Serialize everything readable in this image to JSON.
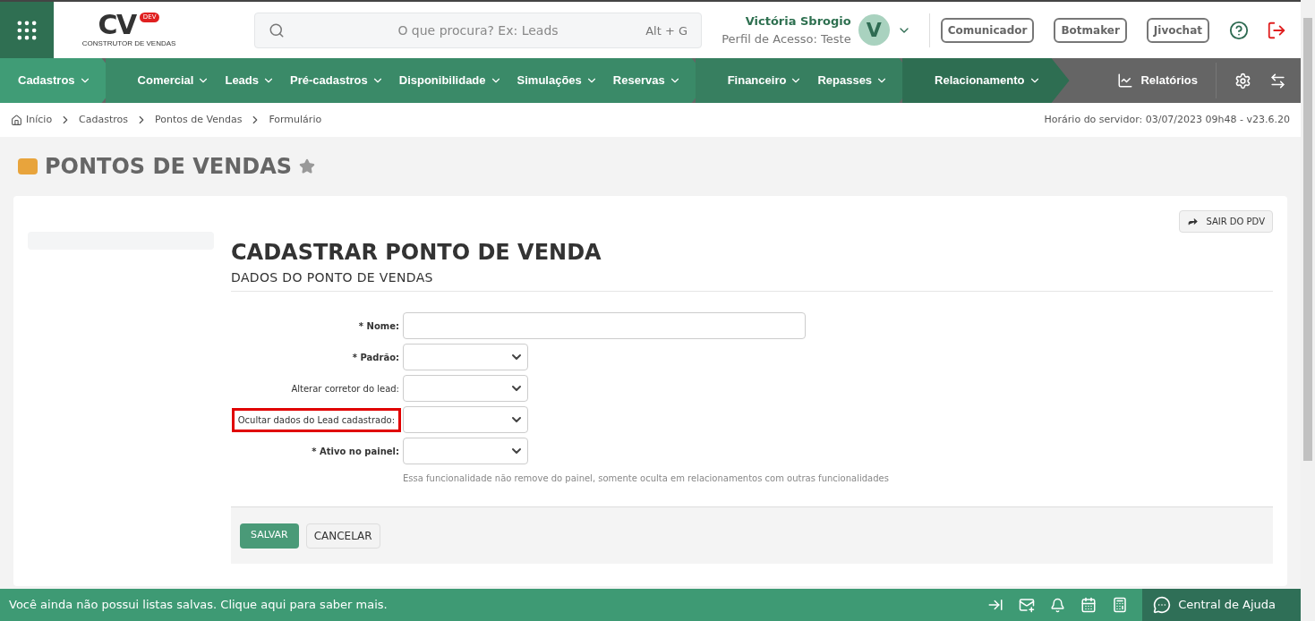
{
  "logo": {
    "letters": "CV",
    "badge": "DEV",
    "tagline": "CONSTRUTOR DE VENDAS"
  },
  "search": {
    "placeholder": "O que procura? Ex: Leads",
    "shortcut": "Alt + G"
  },
  "user": {
    "name": "Victória Sbrogio",
    "profile": "Perfil de Acesso: Teste",
    "initial": "V"
  },
  "header_buttons": [
    "Comunicador",
    "Botmaker",
    "Jivochat"
  ],
  "nav_groups": [
    {
      "color": "#409c76",
      "items": [
        "Cadastros"
      ]
    },
    {
      "color": "#3a8a68",
      "items": [
        "Comercial",
        "Leads",
        "Pré-cadastros",
        "Disponibilidade",
        "Simulações",
        "Reservas"
      ]
    },
    {
      "color": "#377f60",
      "items": [
        "Financeiro",
        "Repasses"
      ]
    },
    {
      "color": "#2e6e52",
      "items": [
        "Relacionamento"
      ]
    }
  ],
  "reports": "Relatórios",
  "breadcrumb": [
    "Início",
    "Cadastros",
    "Pontos de Vendas",
    "Formulário"
  ],
  "server_time": "Horário do servidor: 03/07/2023 09h48 - v23.6.20",
  "page_title": "PONTOS DE VENDAS",
  "exit_button": "SAIR DO PDV",
  "form_title": "CADASTRAR PONTO DE VENDA",
  "section_title": "DADOS DO PONTO DE VENDAS",
  "fields": [
    {
      "kind": "text",
      "label": "Nome:",
      "required": true,
      "highlighted": false
    },
    {
      "kind": "select",
      "label": "Padrão:",
      "required": true,
      "highlighted": false
    },
    {
      "kind": "select",
      "label": "Alterar corretor do lead:",
      "required": false,
      "highlighted": false
    },
    {
      "kind": "select",
      "label": "Ocultar dados do Lead cadastrado:",
      "required": false,
      "highlighted": true
    },
    {
      "kind": "select",
      "label": "Ativo no painel:",
      "required": true,
      "highlighted": false,
      "help": "Essa funcionalidade não remove do painel, somente oculta em relacionamentos com outras funcionalidades"
    }
  ],
  "required_mark": "*",
  "save_button": "SALVAR",
  "cancel_button": "CANCELAR",
  "footer_message": "Você ainda não possui listas salvas. Clique aqui para saber mais.",
  "help_center": "Central de Ajuda"
}
